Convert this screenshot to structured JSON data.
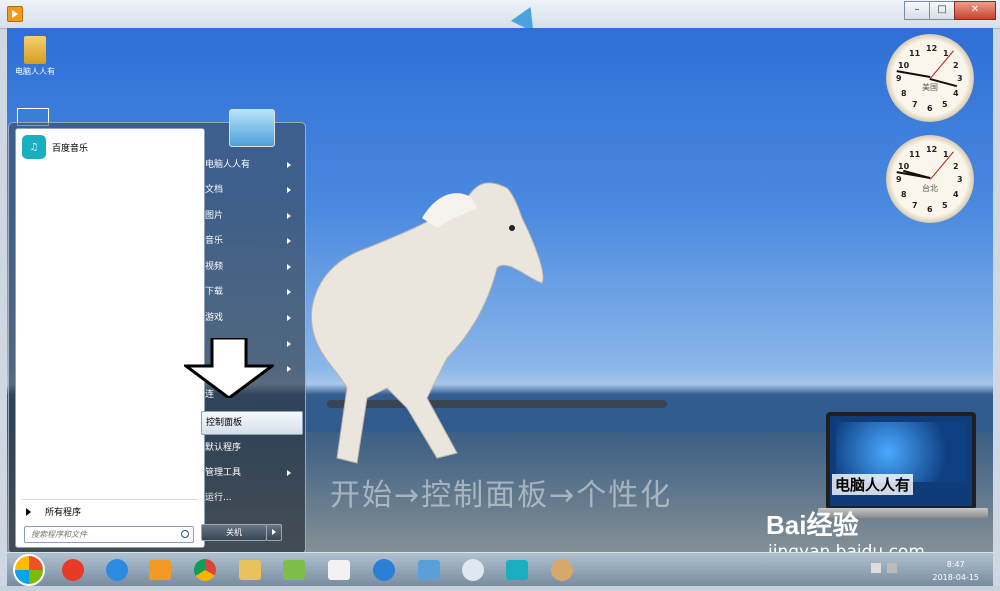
{
  "window": {
    "controls": [
      "–",
      "□",
      "✕"
    ]
  },
  "desktop": {
    "icons": [
      {
        "label": "电脑人人有",
        "icon": "folder-user-icon"
      }
    ],
    "caption_overlay": "开始→控制面板→个性化",
    "watermark": {
      "brand": "Bai经验",
      "url": "jingyan.baidu.com"
    },
    "laptop_widget_label": "电脑人人有"
  },
  "clocks": [
    {
      "city": "美国",
      "numbers": [
        "12",
        "1",
        "2",
        "3",
        "4",
        "5",
        "6",
        "7",
        "8",
        "9",
        "10",
        "11"
      ]
    },
    {
      "city": "台北",
      "numbers": [
        "12",
        "1",
        "2",
        "3",
        "4",
        "5",
        "6",
        "7",
        "8",
        "9",
        "10",
        "11"
      ]
    }
  ],
  "start_menu": {
    "pinned": [
      {
        "label": "百度音乐",
        "icon": "baidu-music-icon"
      }
    ],
    "all_programs": "所有程序",
    "search_placeholder": "搜索程序和文件",
    "right_items": [
      {
        "label": "电脑人人有",
        "arrow": true
      },
      {
        "label": "文档",
        "arrow": true
      },
      {
        "label": "图片",
        "arrow": true
      },
      {
        "label": "音乐",
        "arrow": true
      },
      {
        "label": "视频",
        "arrow": true
      },
      {
        "label": "下载",
        "arrow": true
      },
      {
        "label": "游戏",
        "arrow": true
      },
      {
        "label": "",
        "arrow": true
      },
      {
        "label": "",
        "arrow": true
      },
      {
        "label": "连",
        "arrow": false
      },
      {
        "label": "控制面板",
        "arrow": false,
        "highlighted": true
      },
      {
        "label": "默认程序",
        "arrow": false
      },
      {
        "label": "管理工具",
        "arrow": true
      },
      {
        "label": "运行...",
        "arrow": false
      }
    ],
    "shutdown_label": "关机"
  },
  "taskbar": {
    "items": [
      "start-orb-icon",
      "qihoo-icon",
      "ie-icon",
      "media-player-icon",
      "chrome-icon",
      "explorer-icon",
      "folder-icon",
      "document-icon",
      "browser-icon",
      "remote-desktop-icon",
      "gear-app-icon",
      "baidu-music-icon",
      "paint-icon"
    ],
    "tray": {
      "time": "8:47",
      "date": "2018-04-15"
    }
  },
  "colors": {
    "sky": "#2f6fd6",
    "accent_music": "#1aaec1"
  }
}
